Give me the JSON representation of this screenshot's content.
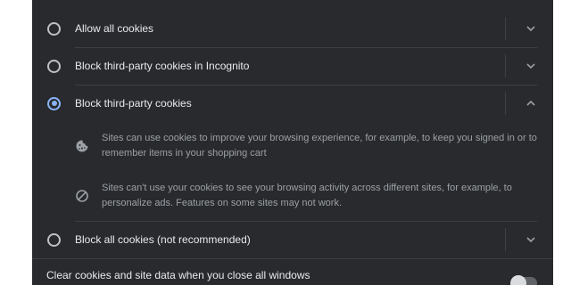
{
  "options": [
    {
      "label": "Allow all cookies",
      "selected": false,
      "expanded": false
    },
    {
      "label": "Block third-party cookies in Incognito",
      "selected": false,
      "expanded": false
    },
    {
      "label": "Block third-party cookies",
      "selected": true,
      "expanded": true
    },
    {
      "label": "Block all cookies (not recommended)",
      "selected": false,
      "expanded": false
    }
  ],
  "expanded_details": [
    {
      "icon": "cookie-icon",
      "text": "Sites can use cookies to improve your browsing experience, for example, to keep you signed in or to remember items in your shopping cart"
    },
    {
      "icon": "block-icon",
      "text": "Sites can't use your cookies to see your browsing activity across different sites, for example, to personalize ads. Features on some sites may not work."
    }
  ],
  "clear_on_exit": {
    "label": "Clear cookies and site data when you close all windows",
    "enabled": false
  },
  "colors": {
    "panel_bg": "#292a2d",
    "text": "#e8eaed",
    "secondary_text": "#9aa0a6",
    "accent": "#8ab4f8",
    "divider": "#3c4043"
  }
}
